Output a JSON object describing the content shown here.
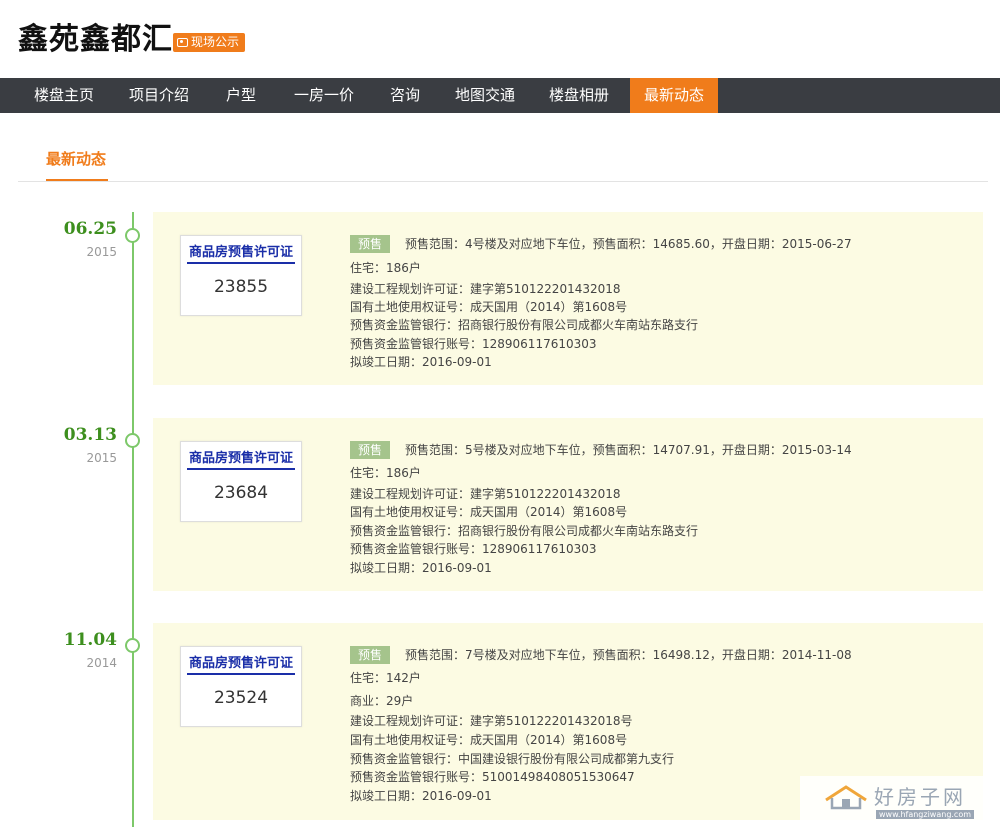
{
  "header": {
    "title": "鑫苑鑫都汇",
    "badge": "现场公示"
  },
  "nav": [
    {
      "label": "楼盘主页"
    },
    {
      "label": "项目介绍"
    },
    {
      "label": "户型"
    },
    {
      "label": "一房一价"
    },
    {
      "label": "咨询"
    },
    {
      "label": "地图交通"
    },
    {
      "label": "楼盘相册"
    },
    {
      "label": "最新动态",
      "active": true
    }
  ],
  "section": {
    "tab": "最新动态"
  },
  "entries": [
    {
      "date": "06.25",
      "year": "2015",
      "permit_title": "商品房预售许可证",
      "permit_number": "23855",
      "tag": "预售",
      "summary": "预售范围：4号楼及对应地下车位，预售面积：14685.60，开盘日期：2015-06-27",
      "details": [
        "住宅：186户",
        "建设工程规划许可证：建字第510122201432018",
        "国有土地使用权证号：成天国用（2014）第1608号",
        "预售资金监管银行：招商银行股份有限公司成都火车南站东路支行",
        "预售资金监管银行账号：128906117610303",
        "拟竣工日期：2016-09-01"
      ]
    },
    {
      "date": "03.13",
      "year": "2015",
      "permit_title": "商品房预售许可证",
      "permit_number": "23684",
      "tag": "预售",
      "summary": "预售范围：5号楼及对应地下车位，预售面积：14707.91，开盘日期：2015-03-14",
      "details": [
        "住宅：186户",
        "建设工程规划许可证：建字第510122201432018",
        "国有土地使用权证号：成天国用（2014）第1608号",
        "预售资金监管银行：招商银行股份有限公司成都火车南站东路支行",
        "预售资金监管银行账号：128906117610303",
        "拟竣工日期：2016-09-01"
      ]
    },
    {
      "date": "11.04",
      "year": "2014",
      "permit_title": "商品房预售许可证",
      "permit_number": "23524",
      "tag": "预售",
      "summary": "预售范围：7号楼及对应地下车位，预售面积：16498.12，开盘日期：2014-11-08",
      "details": [
        "住宅：142户",
        "商业：29户",
        "建设工程规划许可证：建字第510122201432018号",
        "国有土地使用权证号：成天国用（2014）第1608号",
        "预售资金监管银行：中国建设银行股份有限公司成都第九支行",
        "预售资金监管银行账号：51001498408051530647",
        "拟竣工日期：2016-09-01"
      ]
    }
  ],
  "watermark": {
    "text": "好房子网",
    "url": "www.hfangziwang.com"
  },
  "colors": {
    "accent": "#f07c1b",
    "nav_bg": "#3a3d42",
    "timeline": "#7dc86a",
    "date": "#3d8f1e",
    "card_bg": "#fcfbe3",
    "permit": "#1a2ea8",
    "tag": "#a5c48c"
  }
}
